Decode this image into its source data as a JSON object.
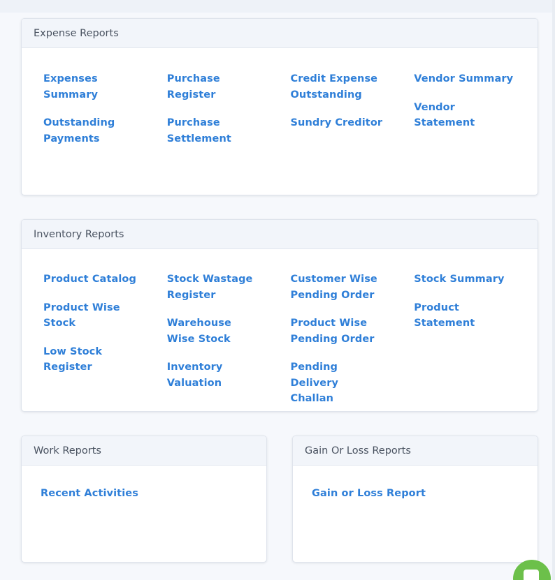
{
  "expense": {
    "title": "Expense Reports",
    "col1": [
      "Expenses Summary",
      "Outstanding Payments"
    ],
    "col2": [
      "Purchase Register",
      "Purchase Settlement"
    ],
    "col3": [
      "Credit Expense Outstanding",
      "Sundry Creditor"
    ],
    "col4": [
      "Vendor Summary",
      "Vendor Statement"
    ]
  },
  "inventory": {
    "title": "Inventory Reports",
    "col1": [
      "Product Catalog",
      "Product Wise Stock",
      "Low Stock Register"
    ],
    "col2": [
      "Stock Wastage Register",
      "Warehouse Wise Stock",
      "Inventory Valuation"
    ],
    "col3": [
      "Customer Wise Pending Order",
      "Product Wise Pending Order",
      "Pending Delivery Challan"
    ],
    "col4": [
      "Stock Summary",
      "Product Statement"
    ]
  },
  "work": {
    "title": "Work Reports",
    "items": [
      "Recent Activities"
    ]
  },
  "gainloss": {
    "title": "Gain Or Loss Reports",
    "items": [
      "Gain or Loss Report"
    ]
  },
  "colors": {
    "link": "#2f7fd8",
    "header_bg": "#f2f5fa",
    "page_bg": "#f6f8fc",
    "fab": "#6cc04a"
  },
  "icons": {
    "chat_fab": "chat-icon"
  }
}
